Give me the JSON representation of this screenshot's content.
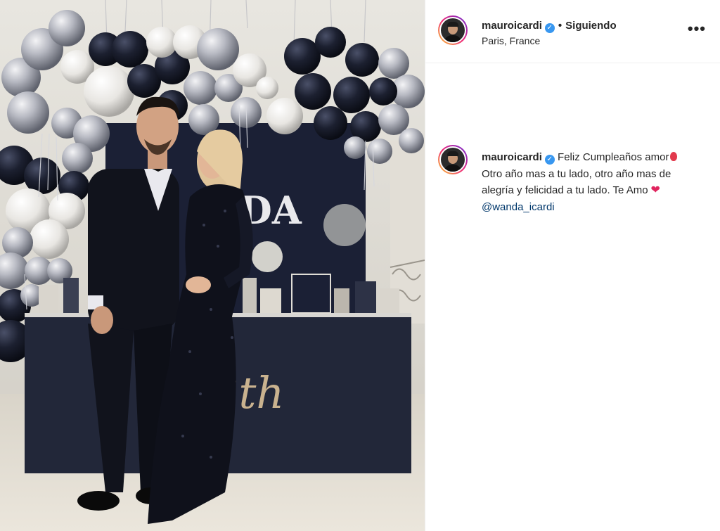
{
  "post": {
    "username": "mauroicardi",
    "verified": true,
    "follow_status": "Siguiendo",
    "location": "Paris, France",
    "more_icon": "more-options-icon"
  },
  "caption": {
    "username": "mauroicardi",
    "text_part1": "Feliz Cumpleaños amor",
    "text_part2": "Otro año mas a tu lado, otro año mas de alegría y felicidad a tu lado. Te Amo",
    "mention": "@wanda_icardi",
    "emoji_1": "balloon-emoji",
    "emoji_2": "heart-emoji"
  },
  "photo": {
    "backdrop_letters": "DA",
    "table_text": "3th"
  },
  "colors": {
    "verified_blue": "#3897f0",
    "mention_blue": "#00376b",
    "heart_red": "#e0245e",
    "backdrop_navy": "#1b2035"
  }
}
